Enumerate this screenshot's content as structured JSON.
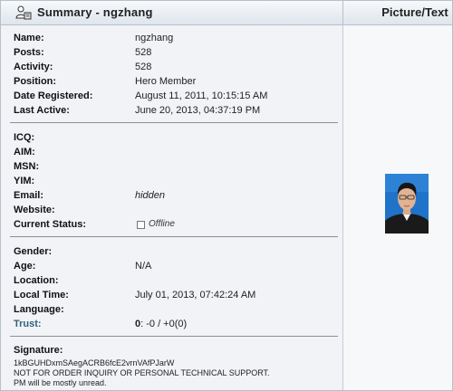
{
  "header": {
    "title": "Summary - ngzhang",
    "right_title": "Picture/Text"
  },
  "profile": {
    "name": {
      "label": "Name:",
      "value": "ngzhang"
    },
    "posts": {
      "label": "Posts:",
      "value": "528"
    },
    "activity": {
      "label": "Activity:",
      "value": "528"
    },
    "position": {
      "label": "Position:",
      "value": "Hero Member"
    },
    "registered": {
      "label": "Date Registered:",
      "value": "August 11, 2011, 10:15:15 AM"
    },
    "last_active": {
      "label": "Last Active:",
      "value": "June 20, 2013, 04:37:19 PM"
    }
  },
  "contact": {
    "icq": {
      "label": "ICQ:"
    },
    "aim": {
      "label": "AIM:"
    },
    "msn": {
      "label": "MSN:"
    },
    "yim": {
      "label": "YIM:"
    },
    "email": {
      "label": "Email:",
      "value": "hidden"
    },
    "website": {
      "label": "Website:"
    },
    "status": {
      "label": "Current Status:",
      "value": "Offline"
    }
  },
  "personal": {
    "gender": {
      "label": "Gender:"
    },
    "age": {
      "label": "Age:",
      "value": "N/A"
    },
    "location": {
      "label": "Location:"
    },
    "local_time": {
      "label": "Local Time:",
      "value": "July 01, 2013, 07:42:24 AM"
    },
    "language": {
      "label": "Language:"
    },
    "trust": {
      "label": "Trust:",
      "score": "0",
      "detail": ": -0 / +0(0)"
    }
  },
  "signature": {
    "label": "Signature:",
    "lines": [
      "1kBGUHDxmSAegACRB6fcE2vrnVAfPJarW",
      "NOT FOR ORDER INQUIRY OR PERSONAL TECHNICAL SUPPORT.",
      "PM will be mostly unread."
    ]
  },
  "avatar": {
    "description_icon": "user-photo"
  }
}
